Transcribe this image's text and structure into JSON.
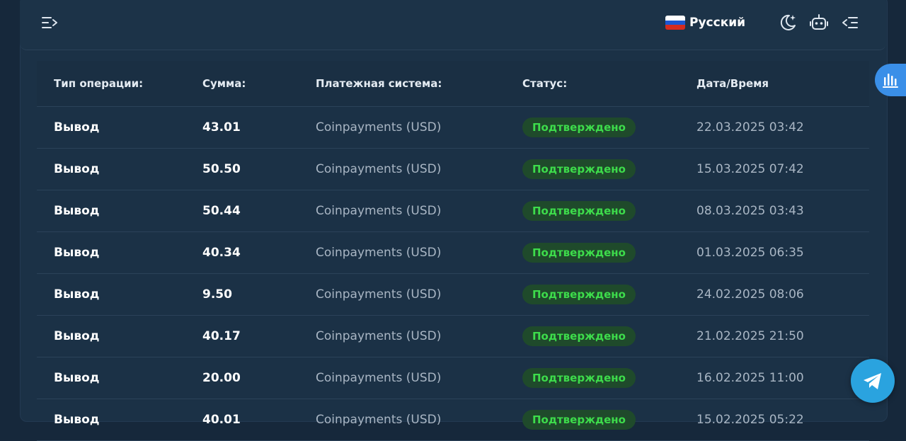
{
  "header": {
    "language": "Русский",
    "icons": [
      "menu-toggle-icon",
      "russia-flag-icon",
      "moon-icon",
      "robot-icon",
      "sidebar-collapse-icon"
    ]
  },
  "table": {
    "columns": [
      "Тип операции:",
      "Сумма:",
      "Платежная система:",
      "Статус:",
      "Дата/Время"
    ],
    "rows": [
      {
        "type": "Вывод",
        "amount": "43.01",
        "system": "Coinpayments (USD)",
        "status": "Подтверждено",
        "date": "22.03.2025 03:42"
      },
      {
        "type": "Вывод",
        "amount": "50.50",
        "system": "Coinpayments (USD)",
        "status": "Подтверждено",
        "date": "15.03.2025 07:42"
      },
      {
        "type": "Вывод",
        "amount": "50.44",
        "system": "Coinpayments (USD)",
        "status": "Подтверждено",
        "date": "08.03.2025 03:43"
      },
      {
        "type": "Вывод",
        "amount": "40.34",
        "system": "Coinpayments (USD)",
        "status": "Подтверждено",
        "date": "01.03.2025 06:35"
      },
      {
        "type": "Вывод",
        "amount": "9.50",
        "system": "Coinpayments (USD)",
        "status": "Подтверждено",
        "date": "24.02.2025 08:06"
      },
      {
        "type": "Вывод",
        "amount": "40.17",
        "system": "Coinpayments (USD)",
        "status": "Подтверждено",
        "date": "21.02.2025 21:50"
      },
      {
        "type": "Вывод",
        "amount": "20.00",
        "system": "Coinpayments (USD)",
        "status": "Подтверждено",
        "date": "16.02.2025 11:00"
      },
      {
        "type": "Вывод",
        "amount": "40.01",
        "system": "Coinpayments (USD)",
        "status": "Подтверждено",
        "date": "15.02.2025 05:22"
      }
    ]
  },
  "colors": {
    "background": "#16283b",
    "panel": "#1b3146",
    "status_bg": "#1f4a2b",
    "status_text": "#3ddc4b",
    "accent": "#3a8fe8",
    "telegram": "#2aa3df"
  },
  "floating": {
    "icons": [
      "stats-icon",
      "telegram-icon"
    ]
  }
}
